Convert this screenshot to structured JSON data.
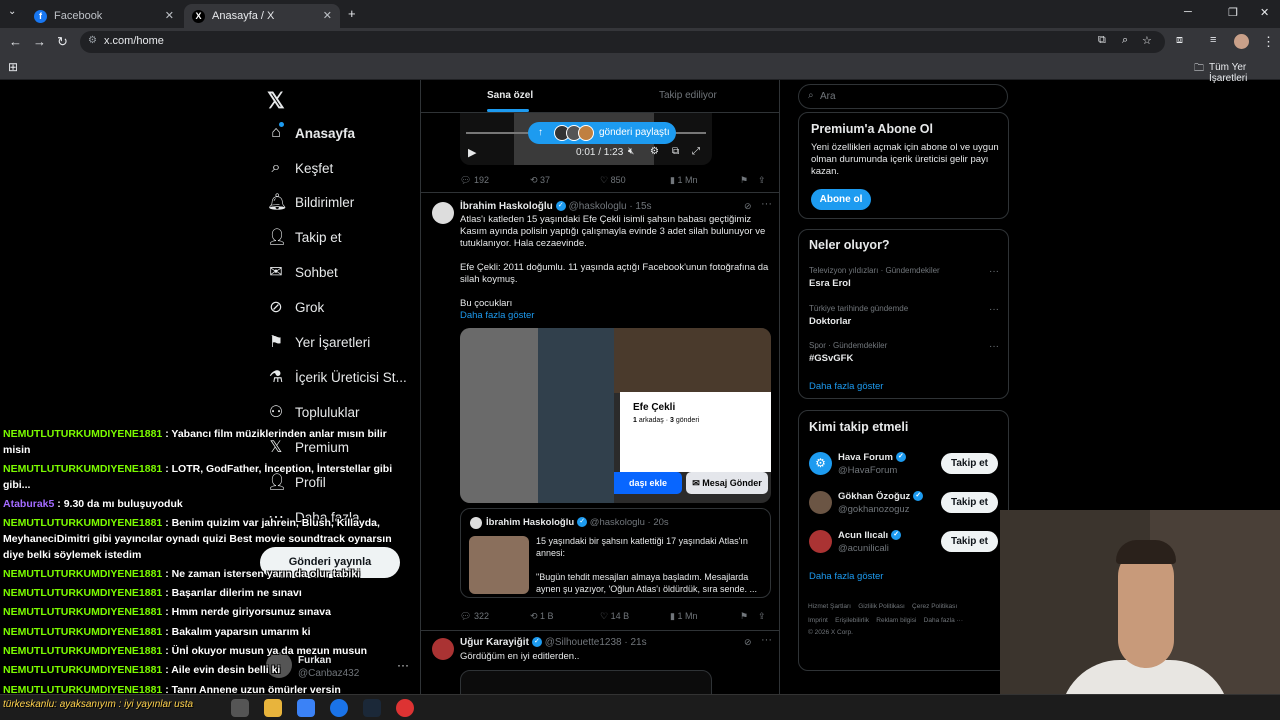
{
  "browser": {
    "tabs": [
      {
        "title": "Facebook",
        "active": false
      },
      {
        "title": "Anasayfa / X",
        "active": true
      }
    ],
    "new_tab": "+",
    "url": "x.com/home",
    "bookmarks_folder": "Tüm Yer İşaretleri"
  },
  "nav": {
    "items": [
      {
        "label": "Anasayfa",
        "icon": "home-icon"
      },
      {
        "label": "Keşfet",
        "icon": "search-icon"
      },
      {
        "label": "Bildirimler",
        "icon": "bell-icon"
      },
      {
        "label": "Takip et",
        "icon": "follow-icon"
      },
      {
        "label": "Sohbet",
        "icon": "mail-icon"
      },
      {
        "label": "Grok",
        "icon": "grok-icon"
      },
      {
        "label": "Yer İşaretleri",
        "icon": "bookmark-icon"
      },
      {
        "label": "İçerik Üreticisi St...",
        "icon": "flask-icon"
      },
      {
        "label": "Topluluklar",
        "icon": "communities-icon"
      },
      {
        "label": "Premium",
        "icon": "x-icon"
      },
      {
        "label": "Profil",
        "icon": "profile-icon"
      },
      {
        "label": "Daha fazla",
        "icon": "more-icon"
      }
    ],
    "post_button": "Gönderi yayınla",
    "account": {
      "name": "Furkan",
      "handle": "@Canbaz432"
    }
  },
  "feed": {
    "tabs": [
      "Sana özel",
      "Takip ediliyor"
    ],
    "video": {
      "share_pill": "gönderi paylaştı",
      "time": "0:01 / 1:23"
    },
    "post0_stats": {
      "replies": "192",
      "reposts": "37",
      "likes": "850",
      "views": "1 Mn"
    },
    "post1": {
      "name": "İbrahim Haskoloğlu",
      "handle": "@haskologlu",
      "time": "· 15s",
      "text1": "Atlas'ı katleden 15 yaşındaki Efe Çekli isimli şahsın babası geçtiğimiz Kasım ayında polisin yaptığı çalışmayla evinde 3 adet silah bulunuyor ve tutuklanıyor. Hala cezaevinde.",
      "text2": "Efe Çekli: 2011 doğumlu. 11 yaşında açtığı Facebook'unun fotoğrafına da silah koymuş.",
      "text3": "Bu çocukları",
      "more": "Daha fazla göster",
      "fb_card": {
        "name": "Efe Çekli",
        "friends_n": "1",
        "friends_l": "arkadaş",
        "posts_n": "3",
        "posts_l": "gönderi",
        "add_friend": "daşı ekle",
        "message": "Mesaj Gönder"
      },
      "quote": {
        "name": "İbrahim Haskoloğlu",
        "handle": "@haskologlu",
        "time": "· 20s",
        "text": "15 yaşındaki bir şahsın katlettiği 17 yaşındaki Atlas'ın annesi:",
        "text2": "\"Bugün tehdit mesajları almaya başladım. Mesajlarda aynen şu yazıyor, 'Oğlun Atlas'ı öldürdük, sıra sende. ..."
      },
      "stats": {
        "replies": "322",
        "reposts": "1 B",
        "likes": "14 B",
        "views": "1 Mn"
      }
    },
    "post2": {
      "name": "Uğur Karayiğit",
      "handle": "@Silhouette1238",
      "time": "· 21s",
      "text": "Gördüğüm en iyi editlerden.."
    }
  },
  "right": {
    "search_placeholder": "Ara",
    "premium": {
      "title": "Premium'a Abone Ol",
      "text": "Yeni özellikleri açmak için abone ol ve uygun olman durumunda içerik üreticisi gelir payı kazan.",
      "button": "Abone ol"
    },
    "trends": {
      "title": "Neler oluyor?",
      "items": [
        {
          "context": "Televizyon yıldızları · Gündemdekiler",
          "name": "Esra Erol"
        },
        {
          "context": "Türkiye tarihinde gündemde",
          "name": "Doktorlar"
        },
        {
          "context": "Spor · Gündemdekiler",
          "name": "#GSvGFK"
        }
      ],
      "more": "Daha fazla göster"
    },
    "who_to_follow": {
      "title": "Kimi takip etmeli",
      "items": [
        {
          "name": "Hava Forum",
          "handle": "@HavaForum"
        },
        {
          "name": "Gökhan Özoğuz",
          "handle": "@gokhanozoguz"
        },
        {
          "name": "Acun Ilıcalı",
          "handle": "@acunilicali"
        }
      ],
      "button": "Takip et",
      "more": "Daha fazla göster"
    },
    "footer": {
      "l1": [
        "Hizmet Şartları",
        "Gizlilik Politikası",
        "Çerez Politikası"
      ],
      "l2": [
        "Imprint",
        "Erişilebilirlik",
        "Reklam bilgisi",
        "Daha fazla ···"
      ],
      "copy": "© 2026 X Corp."
    }
  },
  "chat": [
    {
      "user": "NEMUTLUTURKUMDIYENE1881",
      "text": " : Yabancı film müziklerinden anlar mısın bilir misin"
    },
    {
      "user": "NEMUTLUTURKUMDIYENE1881",
      "text": " : LOTR, GodFather, İnception, İnterstellar gibi gibi..."
    },
    {
      "user": "Ataburak5",
      "text": " : 9.30 da mı buluşuyoduk",
      "alt": true
    },
    {
      "user": "NEMUTLUTURKUMDIYENE1881",
      "text": " : Benim quizim var jahrein, Blush, Killayda, MeyhaneciDimitri gibi yayıncılar oynadı quizi Best movie soundtrack oynarsın diye belki söylemek istedim"
    },
    {
      "user": "NEMUTLUTURKUMDIYENE1881",
      "text": " : Ne zaman istersen yarın da olur tabiki"
    },
    {
      "user": "NEMUTLUTURKUMDIYENE1881",
      "text": " : Başarılar dilerim ne sınavı"
    },
    {
      "user": "NEMUTLUTURKUMDIYENE1881",
      "text": " : Hmm nerde giriyorsunuz sınava"
    },
    {
      "user": "NEMUTLUTURKUMDIYENE1881",
      "text": " : Bakalım yaparsın umarım ki"
    },
    {
      "user": "NEMUTLUTURKUMDIYENE1881",
      "text": " : Ünİ okuyor musun ya da mezun musun"
    },
    {
      "user": "NEMUTLUTURKUMDIYENE1881",
      "text": " : Aile evin desin belli ki"
    },
    {
      "user": "NEMUTLUTURKUMDIYENE1881",
      "text": " : Tanrı Annene uzun ömürler versin"
    }
  ],
  "taskbar_chat": "türkeskanlu: ayaksanıyım : iyi yayınlar usta",
  "colors": {
    "accent": "#1d9bf0",
    "bg": "#000000",
    "chat_user": "#7cfc00"
  }
}
